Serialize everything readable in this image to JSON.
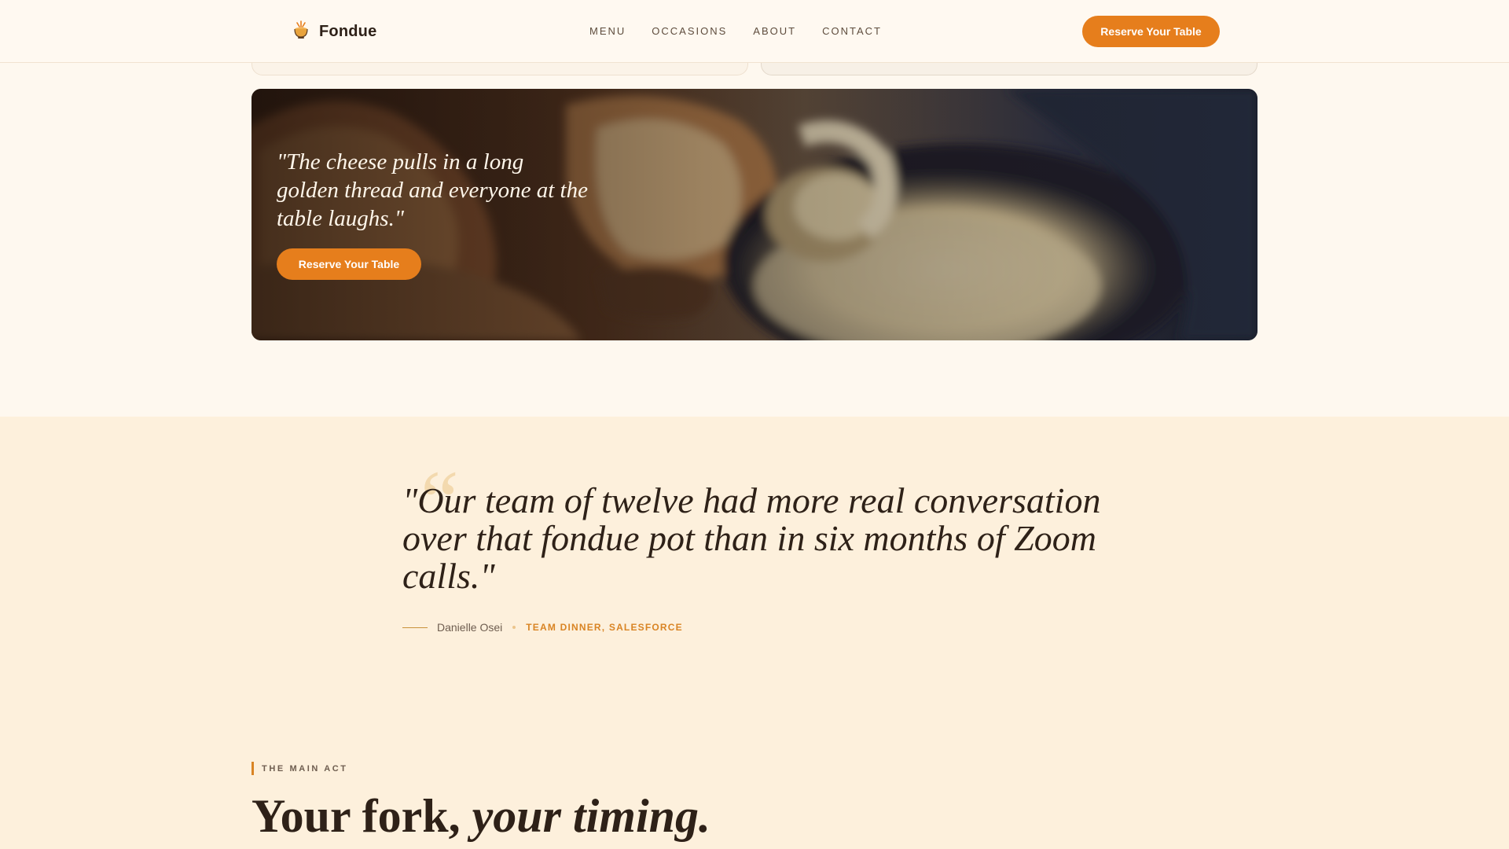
{
  "nav": {
    "brand": "Fondue",
    "links": [
      "MENU",
      "OCCASIONS",
      "ABOUT",
      "CONTACT"
    ],
    "cta": "Reserve Your Table"
  },
  "photo_card": {
    "quote": "\"The cheese pulls in a long golden thread and everyone at the table laughs.\"",
    "cta": "Reserve Your Table"
  },
  "testimonial": {
    "quote_mark": "“",
    "quote": "\"Our team of twelve had more real conversation over that fondue pot than in six months of Zoom calls.\"",
    "name": "Danielle Osei",
    "role": "TEAM DINNER, SALESFORCE"
  },
  "main_act": {
    "eyebrow": "THE MAIN ACT",
    "title_plain": "Your fork,",
    "title_italic": "your timing."
  },
  "colors": {
    "accent": "#e67e1c",
    "background": "#fef8ef",
    "testimonial_bg": "#fdf0dc",
    "text": "#2e2118"
  },
  "icons": {
    "brand": "fondue-pot-icon"
  }
}
